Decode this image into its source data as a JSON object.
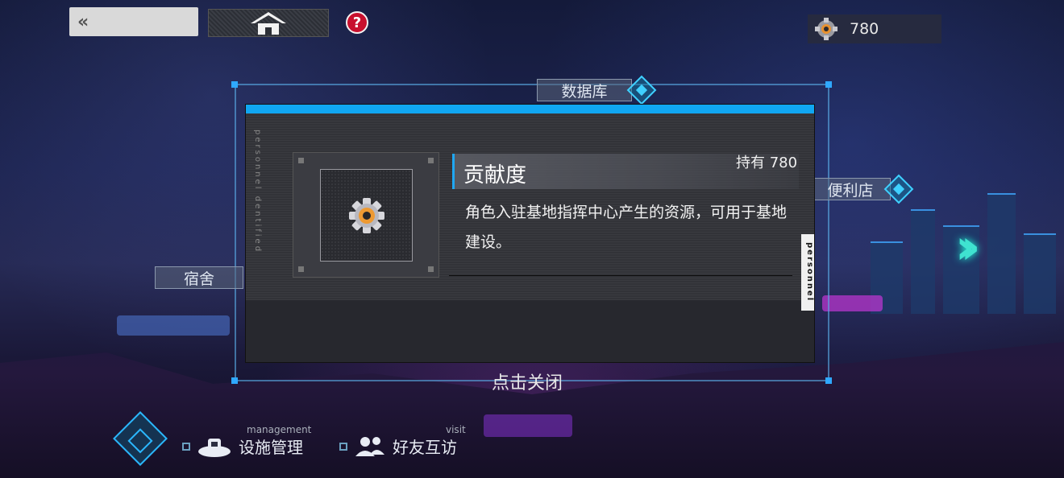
{
  "header": {
    "back_icon": "double-chevron-left-icon",
    "home_icon": "home-icon",
    "help_icon": "help-icon",
    "help_glyph": "?",
    "currency_icon": "gear-icon",
    "currency_value": "780"
  },
  "map": {
    "labels": {
      "database": "数据库",
      "dormitory": "宿舍",
      "store": "便利店"
    }
  },
  "modal": {
    "side_text_left": "personnel dentified",
    "side_text_right": "personnel",
    "item_icon": "gear-icon",
    "title": "贡献度",
    "owned": "持有 780",
    "description": "角色入驻基地指挥中心产生的资源，可用于基地建设。"
  },
  "close_hint": "点击关闭",
  "bottom_nav": {
    "management_sub": "management",
    "management_label": "设施管理",
    "visit_sub": "visit",
    "visit_label": "好友互访"
  },
  "colors": {
    "accent": "#10a7f2",
    "help_red": "#c8102e",
    "neon_cyan": "#3fe3d0"
  }
}
